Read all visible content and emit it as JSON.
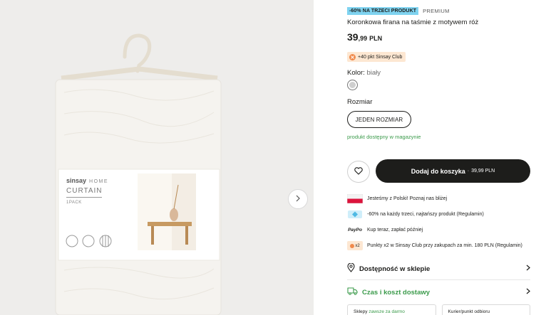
{
  "product": {
    "promo_tag": "-60% NA TRZECI PRODUKT",
    "premium_tag": "PREMIUM",
    "title": "Koronkowa firana na taśmie z motywem róż",
    "price_int": "39",
    "price_dec": ",99",
    "currency": "PLN",
    "club_points": "+40 pkt Sinsay Club",
    "color_label": "Kolor:",
    "color_value": "biały",
    "size_label": "Rozmiar",
    "size_option": "JEDEN ROZMIAR",
    "stock_status": "produkt dostępny w magazynie"
  },
  "actions": {
    "cart_label": "Dodaj do koszyka",
    "cart_sep": "·",
    "cart_price": "39,99 PLN"
  },
  "info": [
    {
      "icon": "poland-flag-icon",
      "text": "Jesteśmy z Polski! Poznaj nas bliżej"
    },
    {
      "icon": "discount-tag-icon",
      "text": "-60% na każdy trzeci, najtańszy produkt (Regulamin)"
    },
    {
      "icon": "paypo-logo-icon",
      "icon_text": "PayPo",
      "text": "Kup teraz, zapłać później"
    },
    {
      "icon": "club-x2-icon",
      "icon_text": "x2",
      "text": "Punkty x2 w Sinsay Club przy zakupach za min. 180 PLN (Regulamin)"
    }
  ],
  "sections": {
    "availability": "Dostępność w sklepie",
    "delivery": "Czas i koszt dostawy"
  },
  "shipping": {
    "store_label": "Sklepy",
    "store_note": "zawsze za darmo",
    "courier_label": "Kurier/punkt odbioru"
  },
  "packaging": {
    "brand": "sinsay",
    "line": "HOME",
    "product": "CURTAIN",
    "pack": "1PACK"
  },
  "colors": {
    "promo": "#7fd3f0",
    "accent_green": "#3a9a4a",
    "cart_bg": "#1d1d1b",
    "club": "#f08a4b"
  }
}
